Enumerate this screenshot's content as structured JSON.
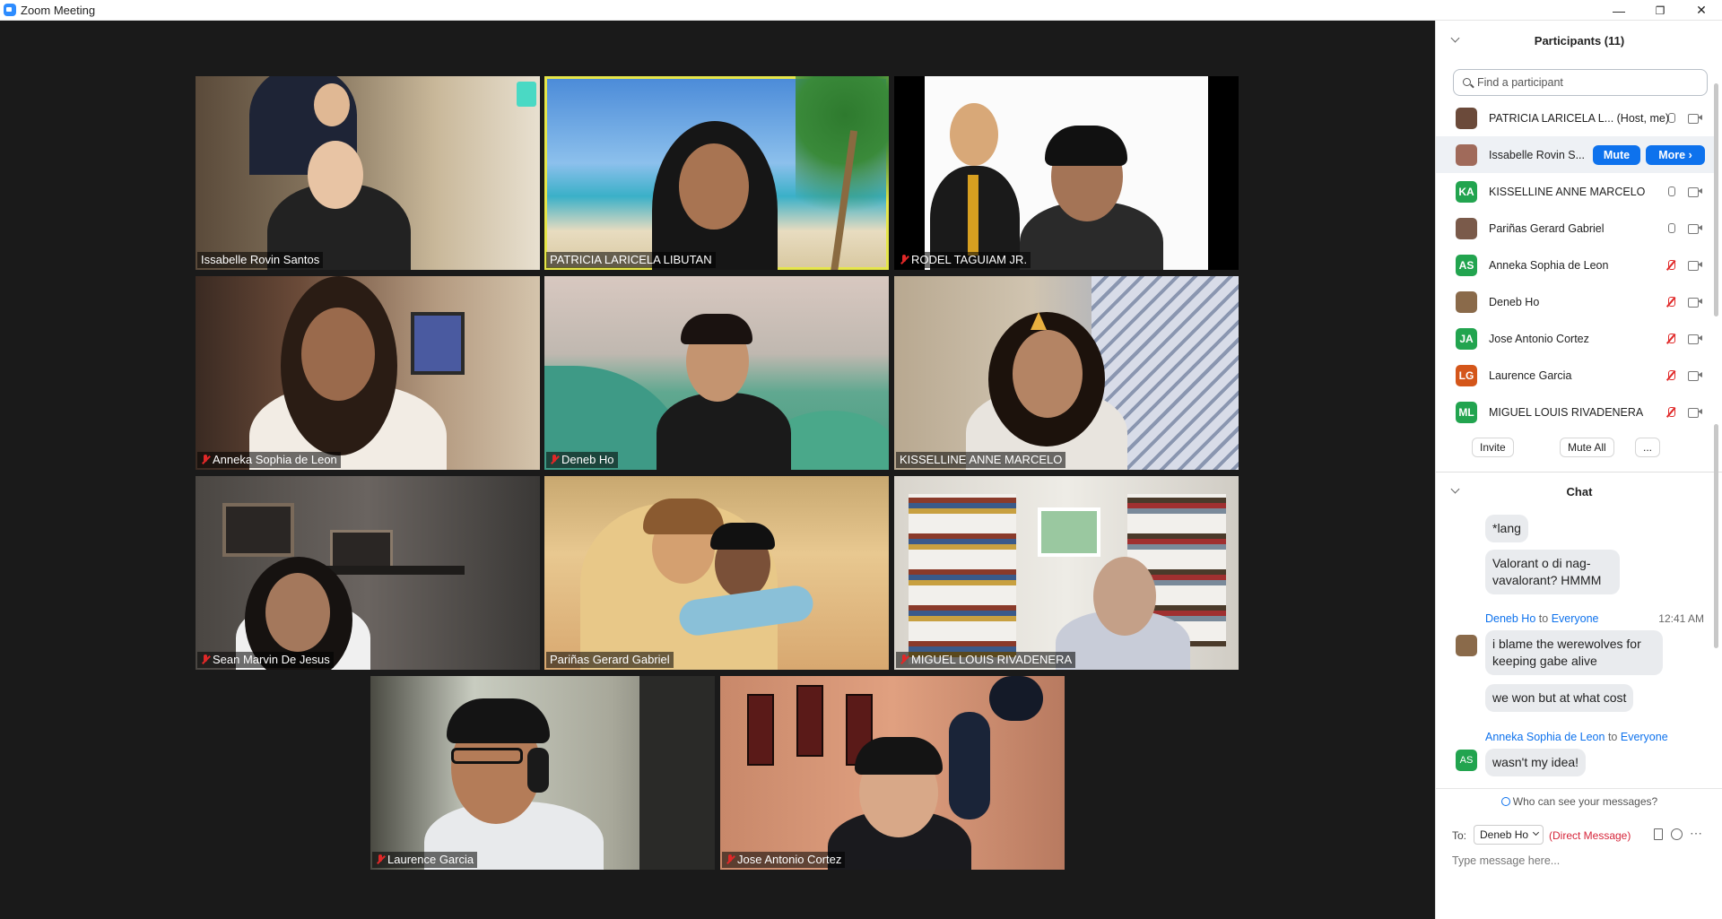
{
  "window": {
    "title": "Zoom Meeting",
    "minimize": "—",
    "restore": "❐",
    "close": "✕"
  },
  "tiles": [
    {
      "name": "Issabelle Rovin Santos",
      "muted": false
    },
    {
      "name": "PATRICIA LARICELA LIBUTAN",
      "muted": false,
      "active_speaker": true
    },
    {
      "name": "RODEL TAGUIAM JR.",
      "muted": true
    },
    {
      "name": "Anneka Sophia de Leon",
      "muted": true
    },
    {
      "name": "Deneb Ho",
      "muted": true
    },
    {
      "name": "KISSELLINE ANNE MARCELO",
      "muted": false
    },
    {
      "name": "Sean Marvin De Jesus",
      "muted": true
    },
    {
      "name": "Pariñas Gerard Gabriel",
      "muted": false
    },
    {
      "name": "MIGUEL LOUIS RIVADENERA",
      "muted": true
    },
    {
      "name": "Laurence Garcia",
      "muted": true
    },
    {
      "name": "Jose Antonio Cortez",
      "muted": true
    }
  ],
  "participants": {
    "header": "Participants (11)",
    "search_placeholder": "Find a participant",
    "list": [
      {
        "name": "PATRICIA LARICELA L... (Host, me)",
        "mic": "on",
        "avatar_color": "#6b4a3a"
      },
      {
        "name": "Issabelle Rovin S...",
        "mic": "none",
        "avatar_color": "#a06a5a",
        "selected": true,
        "mute_label": "Mute",
        "more_label": "More ›"
      },
      {
        "name": "KISSELLINE ANNE MARCELO",
        "mic": "on",
        "initials": "KA",
        "avatar_color": "#22a44f"
      },
      {
        "name": "Pariñas Gerard Gabriel",
        "mic": "on",
        "avatar_color": "#7a5a4a"
      },
      {
        "name": "Anneka Sophia de Leon",
        "mic": "muted",
        "initials": "AS",
        "avatar_color": "#22a44f"
      },
      {
        "name": "Deneb Ho",
        "mic": "muted",
        "avatar_color": "#8a6a4a"
      },
      {
        "name": "Jose Antonio Cortez",
        "mic": "muted",
        "initials": "JA",
        "avatar_color": "#22a44f"
      },
      {
        "name": "Laurence Garcia",
        "mic": "muted",
        "initials": "LG",
        "avatar_color": "#d4561a"
      },
      {
        "name": "MIGUEL LOUIS RIVADENERA",
        "mic": "muted",
        "initials": "ML",
        "avatar_color": "#22a44f"
      }
    ],
    "buttons": {
      "invite": "Invite",
      "mute_all": "Mute All",
      "more": "..."
    }
  },
  "chat": {
    "header": "Chat",
    "messages": [
      {
        "text": "*lang"
      },
      {
        "text": "Valorant o di nag-vavalorant? HMMM"
      },
      {
        "sender": "Deneb Ho",
        "to_word": "to",
        "recipient": "Everyone",
        "time": "12:41 AM",
        "text": "i blame the werewolves for keeping gabe alive"
      },
      {
        "text": "we won but at what cost"
      },
      {
        "sender": "Anneka Sophia de Leon",
        "to_word": "to",
        "recipient": "Everyone",
        "initials": "AS",
        "text": "wasn't my idea!"
      }
    ],
    "who_can_see": "Who can see your messages?",
    "to_label": "To:",
    "recipient_select": "Deneb Ho",
    "direct_message": "(Direct Message)",
    "input_placeholder": "Type message here..."
  }
}
